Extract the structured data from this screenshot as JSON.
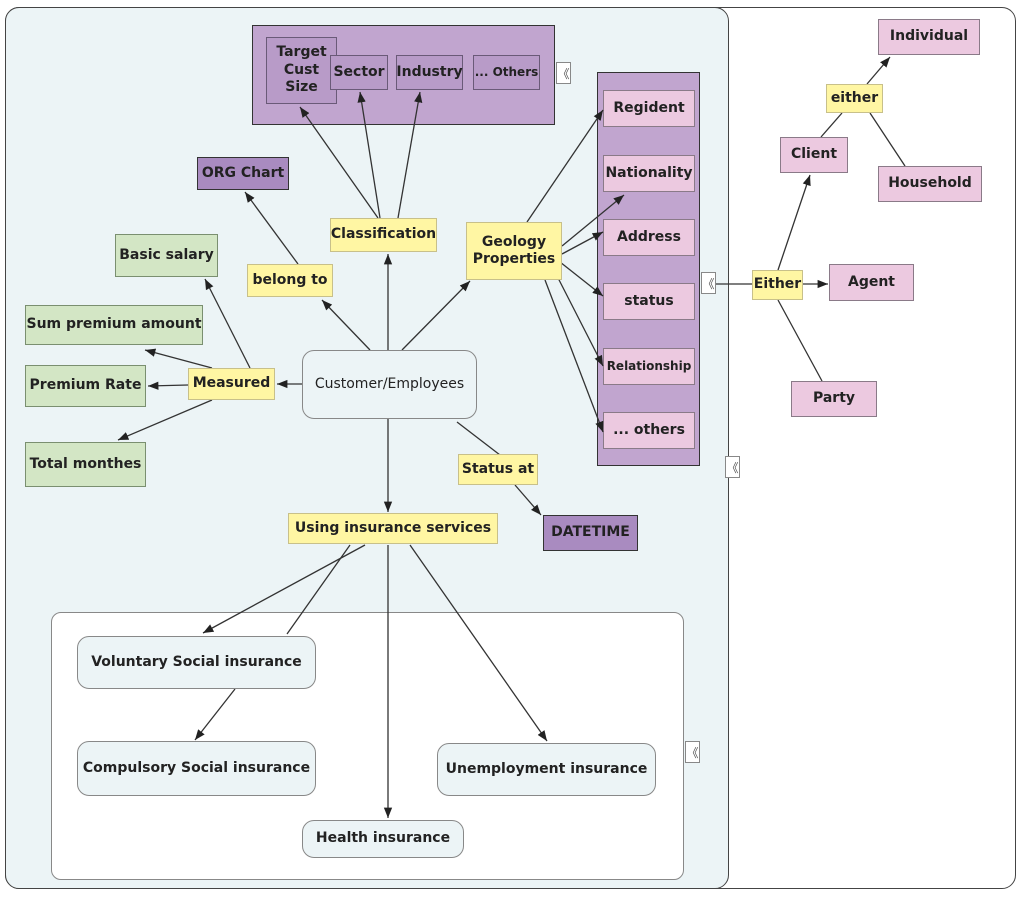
{
  "classification_group": {
    "items": [
      "Target\nCust\nSize",
      "Sector",
      "Industry",
      "... Others"
    ]
  },
  "properties_group": {
    "items": [
      "Regident",
      "Nationality",
      "Address",
      "status",
      "Relationship",
      "... others"
    ]
  },
  "nodes": {
    "org_chart": "ORG Chart",
    "classification": "Classification",
    "geology": "Geology\nProperties",
    "basic_salary": "Basic salary",
    "belong_to": "belong to",
    "sum_premium": "Sum premium amount",
    "premium_rate": "Premium Rate",
    "measured": "Measured",
    "customer": "Customer/Employees",
    "total_monthes": "Total monthes",
    "status_at": "Status at",
    "datetime": "DATETIME",
    "using": "Using insurance services",
    "voluntary": "Voluntary Social insurance",
    "compulsory": "Compulsory Social insurance",
    "unemployment": "Unemployment insurance",
    "health": "Health insurance",
    "individual": "Individual",
    "either_lower": "either",
    "client": "Client",
    "household": "Household",
    "either_upper": "Either",
    "agent": "Agent",
    "party": "Party"
  },
  "icons": {
    "collapse": "《"
  },
  "colors": {
    "panel": "#ecf4f6",
    "yellow": "#fff6a3",
    "green": "#d3e6c5",
    "pink": "#ecc9e0",
    "purple": "#a98bc0",
    "container": "#c1a5cf"
  }
}
